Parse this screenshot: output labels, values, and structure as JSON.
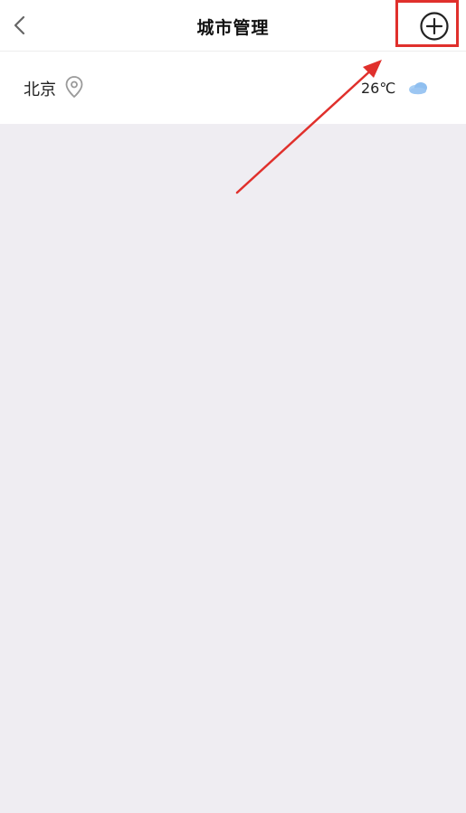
{
  "header": {
    "title": "城市管理",
    "back_icon": "chevron-left-icon",
    "add_icon": "plus-circle-icon"
  },
  "city_list": [
    {
      "name": "北京",
      "location_icon": "location-pin-icon",
      "temperature": "26℃",
      "weather_icon": "cloud-icon"
    }
  ],
  "colors": {
    "annotation": "#e0302c",
    "background": "#efedf2",
    "weather_blue": "#8fbff0"
  }
}
